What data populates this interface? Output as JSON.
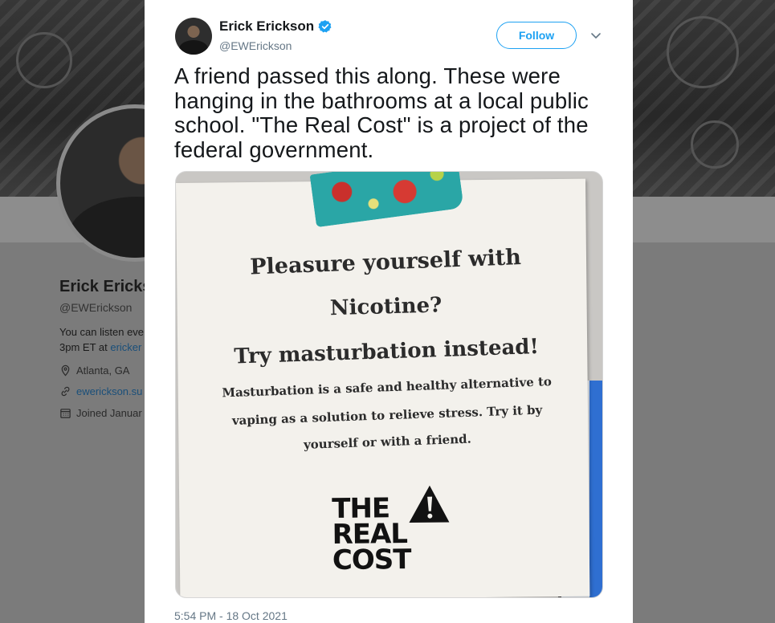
{
  "background_profile": {
    "name": "Erick Ericks",
    "handle": "@EWErickson",
    "bio_line1": "You can listen eve",
    "bio_line2_prefix": "3pm ET at ",
    "bio_line2_link": "ericker",
    "location": "Atlanta, GA",
    "website": "ewerickson.su",
    "joined": "Joined Januar"
  },
  "tweet": {
    "author_name": "Erick Erickson",
    "author_handle": "@EWErickson",
    "follow_label": "Follow",
    "text": "A friend passed this along. These were hanging in the bathrooms at a local public school.  \"The Real Cost\" is a project of the federal government.",
    "timestamp": "5:54 PM - 18 Oct 2021"
  },
  "photo_sign": {
    "line1": "Pleasure yourself with",
    "line2": "Nicotine?",
    "line3": "Try masturbation instead!",
    "line4": "Masturbation is a safe and healthy alternative to",
    "line5": "vaping as a solution to relieve stress. Try it by",
    "line6": "yourself or with a friend.",
    "logo_line1": "THE",
    "logo_line2": "REAL",
    "logo_line3": "COST"
  },
  "icons": {
    "verified": "verified-badge-icon",
    "caret": "chevron-down-icon",
    "location": "location-pin-icon",
    "link": "link-icon",
    "calendar": "calendar-icon"
  },
  "colors": {
    "accent": "#1da1f2",
    "text": "#14171a",
    "muted": "#657786"
  }
}
